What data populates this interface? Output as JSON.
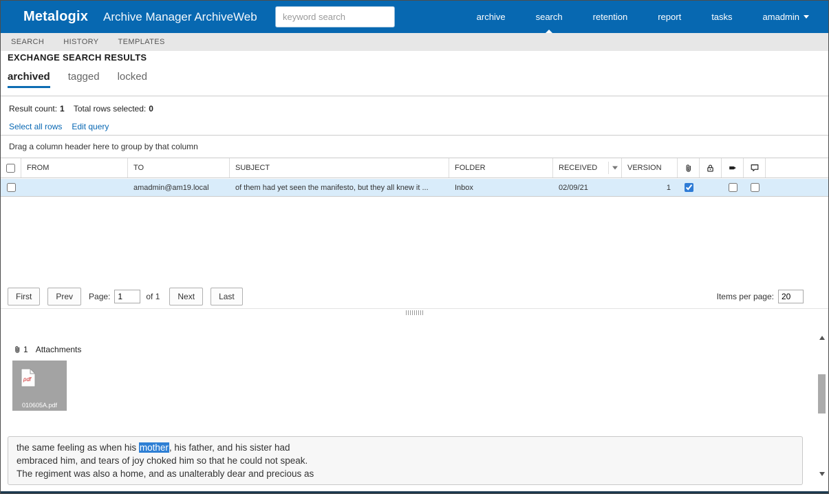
{
  "topbar": {
    "brand": "Metalogix",
    "app_title": "Archive Manager ArchiveWeb",
    "search_placeholder": "keyword search",
    "nav": [
      {
        "label": "archive"
      },
      {
        "label": "search"
      },
      {
        "label": "retention"
      },
      {
        "label": "report"
      },
      {
        "label": "tasks"
      },
      {
        "label": "amadmin"
      }
    ]
  },
  "subnav": {
    "items": [
      "SEARCH",
      "HISTORY",
      "TEMPLATES"
    ]
  },
  "page_title": "EXCHANGE SEARCH RESULTS",
  "tabs": [
    "archived",
    "tagged",
    "locked"
  ],
  "summary": {
    "result_count_label": "Result count:",
    "result_count_value": "1",
    "rows_selected_label": "Total rows selected:",
    "rows_selected_value": "0",
    "select_all_rows": "Select all rows",
    "edit_query": "Edit query",
    "group_hint": "Drag a column header here to group by that column"
  },
  "table": {
    "columns": [
      "FROM",
      "TO",
      "SUBJECT",
      "FOLDER",
      "RECEIVED",
      "VERSION"
    ],
    "icon_columns": [
      "paperclip-icon",
      "lock-icon",
      "tag-icon",
      "comment-icon"
    ],
    "rows": [
      {
        "from": "",
        "to": "amadmin@am19.local",
        "subject": "of them had yet seen the manifesto, but they all knew it ...",
        "folder": "Inbox",
        "received": "02/09/21",
        "version": "1",
        "has_attachment": true,
        "locked": false,
        "tagged": false,
        "commented": false
      }
    ]
  },
  "pagination": {
    "first": "First",
    "prev": "Prev",
    "page_label": "Page:",
    "page_value": "1",
    "of_label": "of 1",
    "next": "Next",
    "last": "Last",
    "items_per_page_label": "Items per page:",
    "items_per_page_value": "20"
  },
  "attachments": {
    "count": "1",
    "label": "Attachments",
    "files": [
      {
        "name": "010605A.pdf",
        "type": "pdf"
      }
    ]
  },
  "preview": {
    "line1_before": "the same feeling as when his ",
    "line1_highlight": "mother",
    "line1_after": ", his father, and his sister had",
    "line2": "embraced him, and tears of joy choked him so that he could not speak.",
    "line3": "The regiment was also a home, and as unalterably dear and precious as"
  },
  "colors": {
    "topbar_blue": "#0768b1",
    "link_blue": "#0767b3",
    "tab_underline": "#0e6db3",
    "row_highlight": "#d9ecfa",
    "text_highlight": "#2e7fd4",
    "bottom_border": "#1d3a50"
  }
}
